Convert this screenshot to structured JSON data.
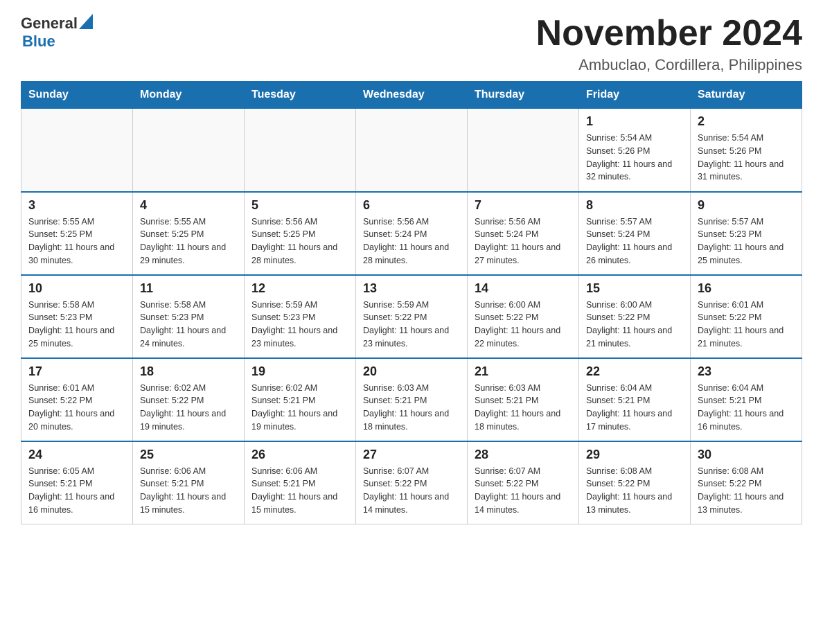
{
  "logo": {
    "general": "General",
    "arrow": "▲",
    "blue": "Blue"
  },
  "title": {
    "month_year": "November 2024",
    "location": "Ambuclao, Cordillera, Philippines"
  },
  "weekdays": [
    "Sunday",
    "Monday",
    "Tuesday",
    "Wednesday",
    "Thursday",
    "Friday",
    "Saturday"
  ],
  "weeks": [
    [
      {
        "day": "",
        "sunrise": "",
        "sunset": "",
        "daylight": ""
      },
      {
        "day": "",
        "sunrise": "",
        "sunset": "",
        "daylight": ""
      },
      {
        "day": "",
        "sunrise": "",
        "sunset": "",
        "daylight": ""
      },
      {
        "day": "",
        "sunrise": "",
        "sunset": "",
        "daylight": ""
      },
      {
        "day": "",
        "sunrise": "",
        "sunset": "",
        "daylight": ""
      },
      {
        "day": "1",
        "sunrise": "Sunrise: 5:54 AM",
        "sunset": "Sunset: 5:26 PM",
        "daylight": "Daylight: 11 hours and 32 minutes."
      },
      {
        "day": "2",
        "sunrise": "Sunrise: 5:54 AM",
        "sunset": "Sunset: 5:26 PM",
        "daylight": "Daylight: 11 hours and 31 minutes."
      }
    ],
    [
      {
        "day": "3",
        "sunrise": "Sunrise: 5:55 AM",
        "sunset": "Sunset: 5:25 PM",
        "daylight": "Daylight: 11 hours and 30 minutes."
      },
      {
        "day": "4",
        "sunrise": "Sunrise: 5:55 AM",
        "sunset": "Sunset: 5:25 PM",
        "daylight": "Daylight: 11 hours and 29 minutes."
      },
      {
        "day": "5",
        "sunrise": "Sunrise: 5:56 AM",
        "sunset": "Sunset: 5:25 PM",
        "daylight": "Daylight: 11 hours and 28 minutes."
      },
      {
        "day": "6",
        "sunrise": "Sunrise: 5:56 AM",
        "sunset": "Sunset: 5:24 PM",
        "daylight": "Daylight: 11 hours and 28 minutes."
      },
      {
        "day": "7",
        "sunrise": "Sunrise: 5:56 AM",
        "sunset": "Sunset: 5:24 PM",
        "daylight": "Daylight: 11 hours and 27 minutes."
      },
      {
        "day": "8",
        "sunrise": "Sunrise: 5:57 AM",
        "sunset": "Sunset: 5:24 PM",
        "daylight": "Daylight: 11 hours and 26 minutes."
      },
      {
        "day": "9",
        "sunrise": "Sunrise: 5:57 AM",
        "sunset": "Sunset: 5:23 PM",
        "daylight": "Daylight: 11 hours and 25 minutes."
      }
    ],
    [
      {
        "day": "10",
        "sunrise": "Sunrise: 5:58 AM",
        "sunset": "Sunset: 5:23 PM",
        "daylight": "Daylight: 11 hours and 25 minutes."
      },
      {
        "day": "11",
        "sunrise": "Sunrise: 5:58 AM",
        "sunset": "Sunset: 5:23 PM",
        "daylight": "Daylight: 11 hours and 24 minutes."
      },
      {
        "day": "12",
        "sunrise": "Sunrise: 5:59 AM",
        "sunset": "Sunset: 5:23 PM",
        "daylight": "Daylight: 11 hours and 23 minutes."
      },
      {
        "day": "13",
        "sunrise": "Sunrise: 5:59 AM",
        "sunset": "Sunset: 5:22 PM",
        "daylight": "Daylight: 11 hours and 23 minutes."
      },
      {
        "day": "14",
        "sunrise": "Sunrise: 6:00 AM",
        "sunset": "Sunset: 5:22 PM",
        "daylight": "Daylight: 11 hours and 22 minutes."
      },
      {
        "day": "15",
        "sunrise": "Sunrise: 6:00 AM",
        "sunset": "Sunset: 5:22 PM",
        "daylight": "Daylight: 11 hours and 21 minutes."
      },
      {
        "day": "16",
        "sunrise": "Sunrise: 6:01 AM",
        "sunset": "Sunset: 5:22 PM",
        "daylight": "Daylight: 11 hours and 21 minutes."
      }
    ],
    [
      {
        "day": "17",
        "sunrise": "Sunrise: 6:01 AM",
        "sunset": "Sunset: 5:22 PM",
        "daylight": "Daylight: 11 hours and 20 minutes."
      },
      {
        "day": "18",
        "sunrise": "Sunrise: 6:02 AM",
        "sunset": "Sunset: 5:22 PM",
        "daylight": "Daylight: 11 hours and 19 minutes."
      },
      {
        "day": "19",
        "sunrise": "Sunrise: 6:02 AM",
        "sunset": "Sunset: 5:21 PM",
        "daylight": "Daylight: 11 hours and 19 minutes."
      },
      {
        "day": "20",
        "sunrise": "Sunrise: 6:03 AM",
        "sunset": "Sunset: 5:21 PM",
        "daylight": "Daylight: 11 hours and 18 minutes."
      },
      {
        "day": "21",
        "sunrise": "Sunrise: 6:03 AM",
        "sunset": "Sunset: 5:21 PM",
        "daylight": "Daylight: 11 hours and 18 minutes."
      },
      {
        "day": "22",
        "sunrise": "Sunrise: 6:04 AM",
        "sunset": "Sunset: 5:21 PM",
        "daylight": "Daylight: 11 hours and 17 minutes."
      },
      {
        "day": "23",
        "sunrise": "Sunrise: 6:04 AM",
        "sunset": "Sunset: 5:21 PM",
        "daylight": "Daylight: 11 hours and 16 minutes."
      }
    ],
    [
      {
        "day": "24",
        "sunrise": "Sunrise: 6:05 AM",
        "sunset": "Sunset: 5:21 PM",
        "daylight": "Daylight: 11 hours and 16 minutes."
      },
      {
        "day": "25",
        "sunrise": "Sunrise: 6:06 AM",
        "sunset": "Sunset: 5:21 PM",
        "daylight": "Daylight: 11 hours and 15 minutes."
      },
      {
        "day": "26",
        "sunrise": "Sunrise: 6:06 AM",
        "sunset": "Sunset: 5:21 PM",
        "daylight": "Daylight: 11 hours and 15 minutes."
      },
      {
        "day": "27",
        "sunrise": "Sunrise: 6:07 AM",
        "sunset": "Sunset: 5:22 PM",
        "daylight": "Daylight: 11 hours and 14 minutes."
      },
      {
        "day": "28",
        "sunrise": "Sunrise: 6:07 AM",
        "sunset": "Sunset: 5:22 PM",
        "daylight": "Daylight: 11 hours and 14 minutes."
      },
      {
        "day": "29",
        "sunrise": "Sunrise: 6:08 AM",
        "sunset": "Sunset: 5:22 PM",
        "daylight": "Daylight: 11 hours and 13 minutes."
      },
      {
        "day": "30",
        "sunrise": "Sunrise: 6:08 AM",
        "sunset": "Sunset: 5:22 PM",
        "daylight": "Daylight: 11 hours and 13 minutes."
      }
    ]
  ]
}
